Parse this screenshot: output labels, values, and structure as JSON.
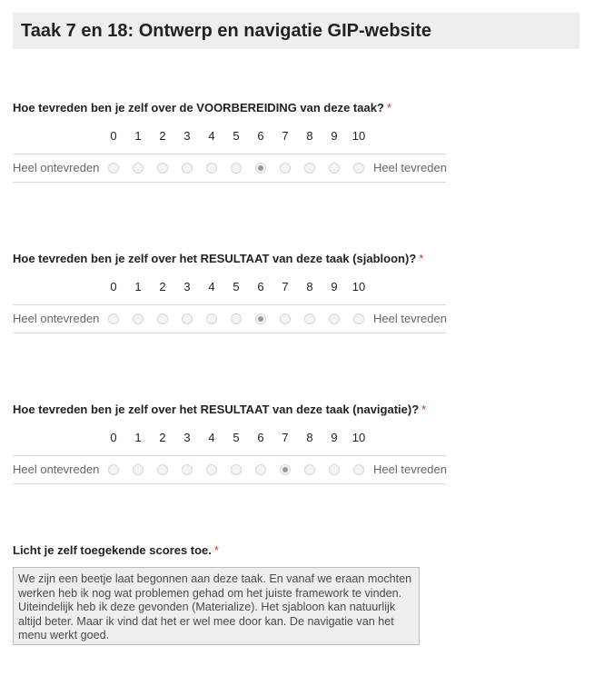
{
  "section": {
    "title": "Taak 7 en 18: Ontwerp en navigatie GIP-website"
  },
  "required_marker": "*",
  "scale": {
    "numbers": [
      "0",
      "1",
      "2",
      "3",
      "4",
      "5",
      "6",
      "7",
      "8",
      "9",
      "10"
    ],
    "low_label": "Heel ontevreden",
    "high_label": "Heel tevreden"
  },
  "questions": [
    {
      "title": "Hoe tevreden ben je zelf over de VOORBEREIDING van deze taak?",
      "selected": 6
    },
    {
      "title": "Hoe tevreden ben je zelf over het RESULTAAT van deze taak (sjabloon)?",
      "selected": 6
    },
    {
      "title": "Hoe tevreden ben je zelf over het RESULTAAT van deze taak (navigatie)?",
      "selected": 7
    }
  ],
  "explanation": {
    "title": "Licht je zelf toegekende scores toe.",
    "value": "We zijn een beetje laat begonnen aan deze taak. En vanaf we eraan mochten werken heb ik nog wat problemen gehad om het juiste framework te vinden. Uiteindelijk heb ik deze gevonden (Materialize). Het sjabloon kan natuurlijk altijd beter. Maar ik vind dat het er wel mee door kan. De navigatie van het menu werkt goed."
  },
  "colors": {
    "header_bg": "#eeeeee",
    "required": "#c43b1d",
    "radio_selected": "#9a9a9a",
    "divider": "#d9d9d9"
  }
}
